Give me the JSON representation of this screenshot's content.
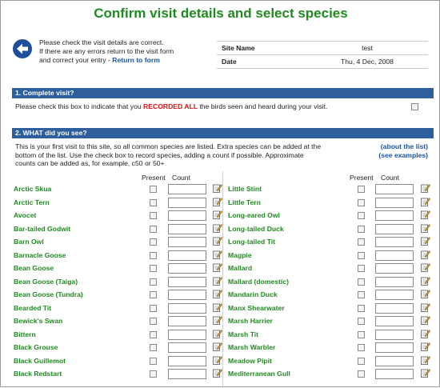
{
  "page": {
    "title": "Confirm visit details and select species"
  },
  "intro": {
    "line1": "Please check the visit details are correct.",
    "line2": "If there are any errors return to the visit form",
    "line3_prefix": "and correct your entry - ",
    "return_link": "Return to form"
  },
  "visit": {
    "site_label": "Site Name",
    "site_value": "test",
    "date_label": "Date",
    "date_value": "Thu, 4 Dec, 2008"
  },
  "section1": {
    "heading": "1. Complete visit?",
    "text_before": "Please check this box to indicate that you ",
    "text_highlight": "RECORDED ALL",
    "text_after": " the birds seen and heard during your visit."
  },
  "section2": {
    "heading": "2. WHAT did you see?",
    "line1": "This is your first visit to this site, so all common species are listed. Extra species can be added at the",
    "line2": "bottom of the list. Use the check box to record species, adding a count if possible. Approximate",
    "line3": "counts can be added as, for example, c50 or 50+",
    "about_link": "(about the list)",
    "examples_link": "(see examples)",
    "present_label": "Present",
    "count_label": "Count"
  },
  "species_left": [
    "Arctic Skua",
    "Arctic Tern",
    "Avocet",
    "Bar-tailed Godwit",
    "Barn Owl",
    "Barnacle Goose",
    "Bean Goose",
    "Bean Goose (Taiga)",
    "Bean Goose (Tundra)",
    "Bearded Tit",
    "Bewick's Swan",
    "Bittern",
    "Black Grouse",
    "Black Guillemot",
    "Black Redstart"
  ],
  "species_right": [
    "Little Stint",
    "Little Tern",
    "Long-eared Owl",
    "Long-tailed Duck",
    "Long-tailed Tit",
    "Magpie",
    "Mallard",
    "Mallard (domestic)",
    "Mandarin Duck",
    "Manx Shearwater",
    "Marsh Harrier",
    "Marsh Tit",
    "Marsh Warbler",
    "Meadow Pipit",
    "Mediterranean Gull"
  ],
  "colors": {
    "title_green": "#1f8a1f",
    "section_blue": "#2f5e9c",
    "link_blue": "#1a56a8",
    "highlight_red": "#dd1111"
  }
}
